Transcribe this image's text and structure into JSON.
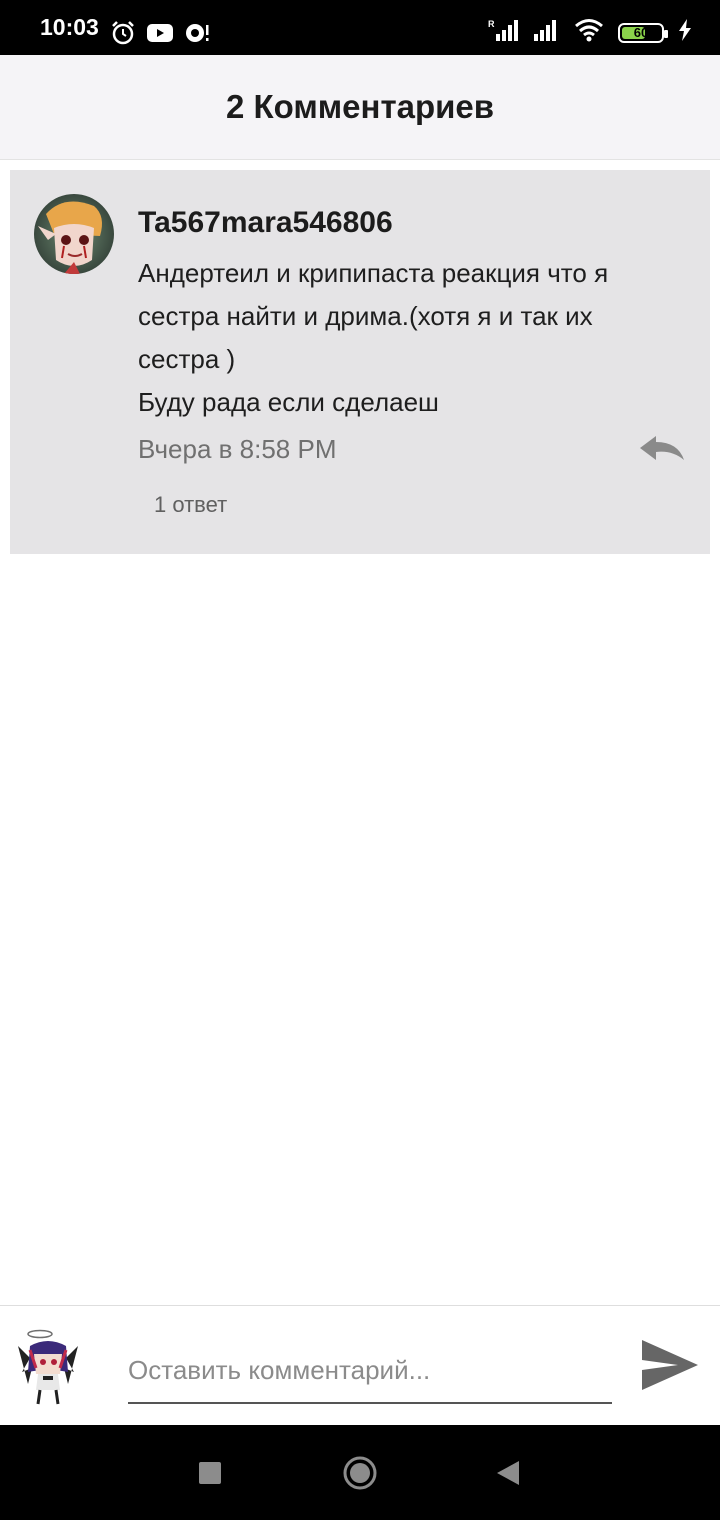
{
  "status_bar": {
    "time": "10:03",
    "battery_level": "60",
    "battery_fraction": 0.6,
    "icons": [
      "alarm-icon",
      "youtube-icon",
      "notification-icon",
      "signal-icon",
      "signal-icon",
      "wifi-icon",
      "battery-icon",
      "charging-icon"
    ]
  },
  "header": {
    "title": "2 Комментариев"
  },
  "comment": {
    "author": "Ta567mara546806",
    "lines": [
      "Андертеил и крипипаста реакция что я",
      "сестра найти  и дрима.(хотя я и так их",
      "сестра )",
      "Буду рада если сделаеш"
    ],
    "time": "Вчера в 8:58 PM",
    "replies": "1 ответ"
  },
  "input": {
    "placeholder": "Оставить комментарий..."
  },
  "colors": {
    "card_background": "#e5e4e6",
    "header_background": "#f5f4f7",
    "battery_green": "#8bd34b"
  }
}
